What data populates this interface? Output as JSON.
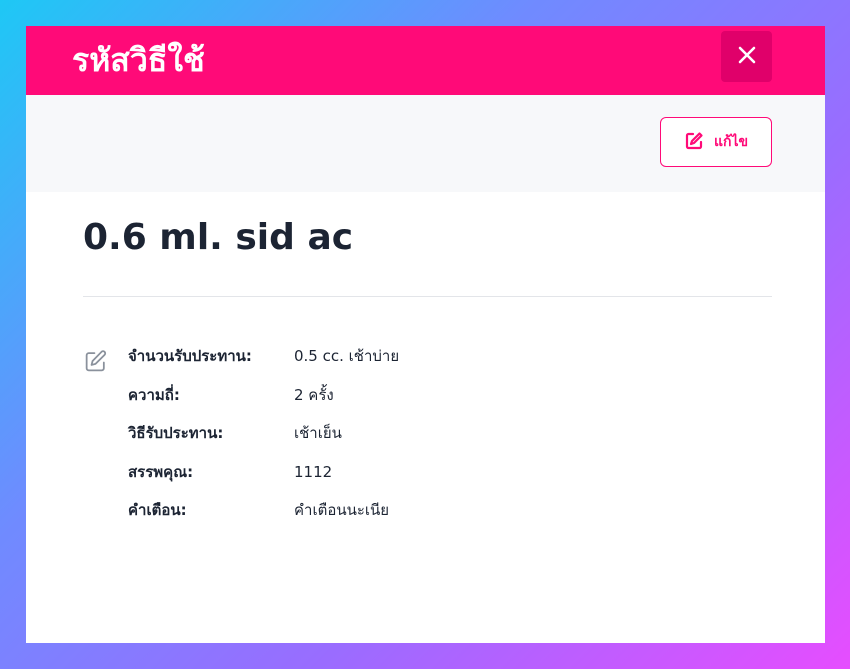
{
  "modal": {
    "title": "รหัสวิธีใช้",
    "close_icon": "close-icon"
  },
  "toolbar": {
    "edit_label": "แก้ไข",
    "edit_icon": "edit-icon"
  },
  "code": "0.6 ml. sid ac",
  "details": {
    "icon": "edit-icon",
    "rows": [
      {
        "label": "จำนวนรับประทาน:",
        "value": "0.5 cc. เช้าบ่าย"
      },
      {
        "label": "ความถี่:",
        "value": "2 ครั้ง"
      },
      {
        "label": "วิธีรับประทาน:",
        "value": "เช้าเย็น"
      },
      {
        "label": "สรรพคุณ:",
        "value": "1112"
      },
      {
        "label": "คำเตือน:",
        "value": "คำเตือนนะเนีย"
      }
    ]
  },
  "colors": {
    "brand": "#ff0a78",
    "brand_dark": "#e0006a",
    "text": "#1c2433",
    "toolbar_bg": "#f7f8fa"
  }
}
